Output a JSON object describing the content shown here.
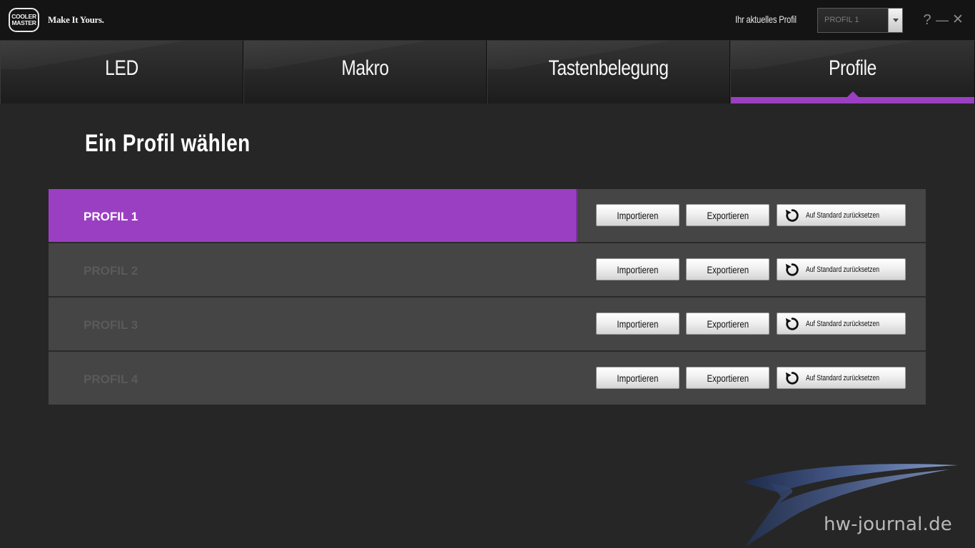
{
  "brand": {
    "logo_line1": "COOLER",
    "logo_line2": "MASTER",
    "tagline": "Make It Yours."
  },
  "header": {
    "current_profile_label": "Ihr aktuelles Profil",
    "current_profile_value": "PROFIL 1",
    "help": "?",
    "minimize": "—",
    "close": "✕"
  },
  "tabs": [
    {
      "label": "LED",
      "active": false
    },
    {
      "label": "Makro",
      "active": false
    },
    {
      "label": "Tastenbelegung",
      "active": false
    },
    {
      "label": "Profile",
      "active": true
    }
  ],
  "main": {
    "heading": "Ein Profil wählen",
    "profiles": [
      {
        "name": "PROFIL 1",
        "selected": true,
        "import": "Importieren",
        "export": "Exportieren",
        "reset": "Auf Standard zurücksetzen"
      },
      {
        "name": "PROFIL 2",
        "selected": false,
        "import": "Importieren",
        "export": "Exportieren",
        "reset": "Auf Standard zurücksetzen"
      },
      {
        "name": "PROFIL 3",
        "selected": false,
        "import": "Importieren",
        "export": "Exportieren",
        "reset": "Auf Standard zurücksetzen"
      },
      {
        "name": "PROFIL 4",
        "selected": false,
        "import": "Importieren",
        "export": "Exportieren",
        "reset": "Auf Standard zurücksetzen"
      }
    ]
  },
  "watermark": {
    "text": "hw-journal.de"
  },
  "colors": {
    "accent": "#9b3fc2",
    "background": "#262626",
    "row": "#454545"
  },
  "icons": {
    "reset": "reset-icon",
    "dropdown": "chevron-down-icon"
  }
}
